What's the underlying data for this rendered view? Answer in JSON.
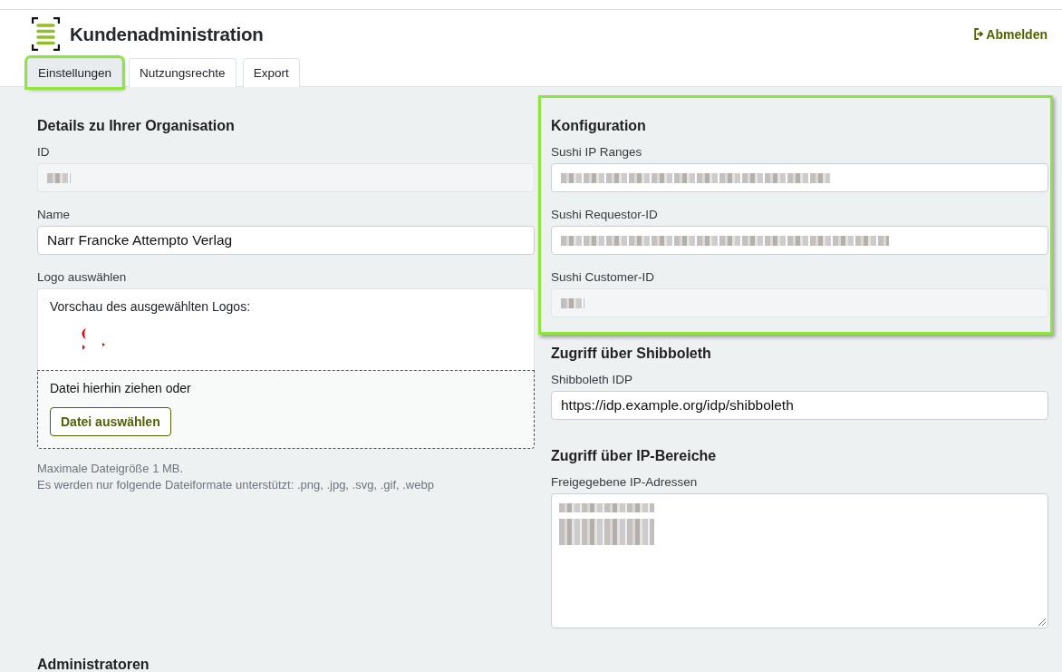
{
  "header": {
    "title": "Kundenadministration",
    "logout": "Abmelden"
  },
  "tabs": [
    {
      "label": "Einstellungen",
      "selected": true,
      "highlighted": true
    },
    {
      "label": "Nutzungsrechte",
      "selected": false,
      "highlighted": false
    },
    {
      "label": "Export",
      "selected": false,
      "highlighted": false
    }
  ],
  "organisation": {
    "heading": "Details zu Ihrer Organisation",
    "fields": [
      {
        "kind": "input",
        "label": "ID",
        "disabled": true,
        "redacted": true
      },
      {
        "kind": "input",
        "label": "Name",
        "value": "Narr Francke Attempto Verlag",
        "disabled": false,
        "redacted": false
      }
    ],
    "logo": {
      "label": "Logo auswählen",
      "preview_label": "Vorschau des ausgewählten Logos:",
      "drop_text": "Datei hierhin ziehen oder",
      "button": "Datei auswählen",
      "hints": [
        "Maximale Dateigröße 1 MB.",
        "Es werden nur folgende Dateiformate unterstützt: .png, .jpg, .svg, .gif, .webp"
      ]
    }
  },
  "sections": [
    {
      "heading": "Konfiguration",
      "highlighted": true,
      "fields": [
        {
          "kind": "input",
          "label": "Sushi IP Ranges",
          "disabled": false,
          "redacted": true
        },
        {
          "kind": "input",
          "label": "Sushi Requestor-ID",
          "disabled": false,
          "redacted": true
        },
        {
          "kind": "input",
          "label": "Sushi Customer-ID",
          "disabled": true,
          "redacted": true
        }
      ]
    },
    {
      "heading": "Zugriff über Shibboleth",
      "highlighted": false,
      "fields": [
        {
          "kind": "input",
          "label": "Shibboleth IDP",
          "value": "https://idp.example.org/idp/shibboleth",
          "disabled": false,
          "redacted": false
        }
      ]
    },
    {
      "heading": "Zugriff über IP-Bereiche",
      "highlighted": false,
      "fields": [
        {
          "kind": "textarea",
          "label": "Freigegebene IP-Adressen",
          "disabled": false,
          "redacted": true
        }
      ]
    }
  ],
  "administrators": {
    "heading": "Administratoren"
  }
}
